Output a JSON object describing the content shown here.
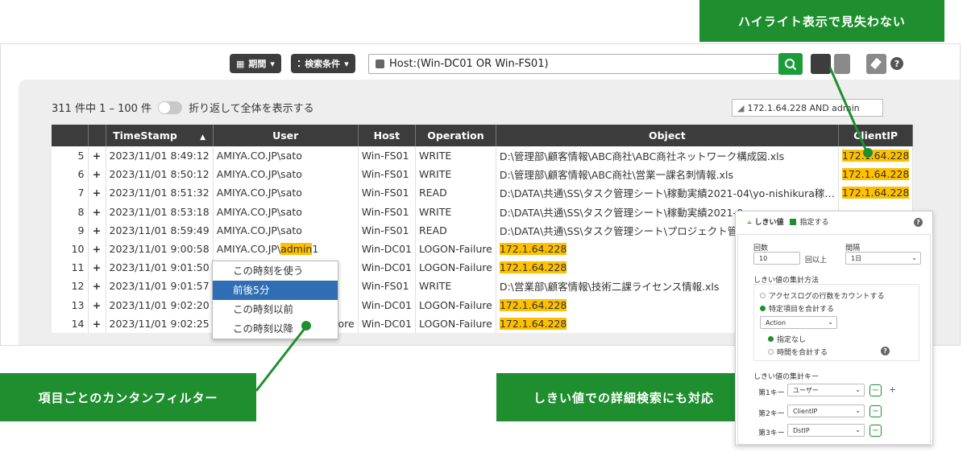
{
  "toolbar": {
    "period_label": "期間",
    "search_cond_label": "検索条件",
    "query": "Host:(Win-DC01 OR Win-FS01)"
  },
  "result": {
    "count_text": "311 件中 1 – 100 件",
    "wrap_label": "折り返して全体を表示する",
    "filter_text": "172.1.64.228  AND admin"
  },
  "table": {
    "headers": [
      "TimeStamp",
      "User",
      "Host",
      "Operation",
      "Object",
      "ClientIP"
    ],
    "rows": [
      {
        "n": "5",
        "ts": "2023/11/01 8:49:12",
        "user": "AMIYA.CO.JP\\sato",
        "host": "Win-FS01",
        "op": "WRITE",
        "obj": "D:\\管理部\\顧客情報\\ABC商社\\ABC商社ネットワーク構成図.xls",
        "ip": "172.1.64.228"
      },
      {
        "n": "6",
        "ts": "2023/11/01 8:50:12",
        "user": "AMIYA.CO.JP\\sato",
        "host": "Win-FS01",
        "op": "WRITE",
        "obj": "D:\\管理部\\顧客情報\\ABC商社\\営業一課名刺情報.xls",
        "ip": "172.1.64.228"
      },
      {
        "n": "7",
        "ts": "2023/11/01 8:51:32",
        "user": "AMIYA.CO.JP\\sato",
        "host": "Win-FS01",
        "op": "READ",
        "obj": "D:\\DATA\\共通\\SS\\タスク管理シート\\稼動実績2021-04\\yo-nishikura稼…",
        "ip": "172.1.64.228"
      },
      {
        "n": "8",
        "ts": "2023/11/01 8:53:18",
        "user": "AMIYA.CO.JP\\sato",
        "host": "Win-FS01",
        "op": "WRITE",
        "obj": "D:\\DATA\\共通\\SS\\タスク管理シート\\稼動実績2021-0",
        "ip": ""
      },
      {
        "n": "9",
        "ts": "2023/11/01 8:59:49",
        "user": "AMIYA.CO.JP\\sato",
        "host": "Win-FS01",
        "op": "READ",
        "obj": "D:\\DATA\\共通\\SS\\タスク管理シート\\プロジェクト管理",
        "ip": ""
      },
      {
        "n": "10",
        "ts": "2023/11/01 9:00:58",
        "user_prefix": "AMIYA.CO.JP\\",
        "user_hl": "admin",
        "user_suffix": "1",
        "host": "Win-DC01",
        "op": "LOGON-Failure",
        "obj_hl": "172.1.64.228",
        "ip": ""
      },
      {
        "n": "11",
        "ts": "2023/11/01 9:01:50",
        "user": "",
        "host": "Win-DC01",
        "op": "LOGON-Failure",
        "obj_hl": "172.1.64.228",
        "ip": ""
      },
      {
        "n": "12",
        "ts": "2023/11/01 9:01:57",
        "user": "",
        "host": "Win-FS01",
        "op": "WRITE",
        "obj": "D:\\営業部\\顧客情報\\技術二課ライセンス情報.xls",
        "ip": ""
      },
      {
        "n": "13",
        "ts": "2023/11/01 9:02:20",
        "user": "",
        "host": "Win-DC01",
        "op": "LOGON-Failure",
        "obj_hl": "172.1.64.228",
        "ip": ""
      },
      {
        "n": "14",
        "ts": "2023/11/01 9:02:25",
        "user": "tore",
        "host": "Win-DC01",
        "op": "LOGON-Failure",
        "obj_hl": "172.1.64.228",
        "ip": ""
      }
    ]
  },
  "context_menu": {
    "items": [
      "この時刻を使う",
      "前後5分",
      "この時刻以前",
      "この時刻以降"
    ]
  },
  "callouts": {
    "top": "ハイライト表示で見失わない",
    "left": "項目ごとのカンタンフィルター",
    "right": "しきい値での詳細検索にも対応"
  },
  "threshold": {
    "title": "しきい値",
    "enable_label": "指定する",
    "count_label": "回数",
    "count_value": "10",
    "count_suffix": "回以上",
    "interval_label": "間隔",
    "interval_value": "1日",
    "method_label": "しきい値の集計方法",
    "opt_count_rows": "アクセスログの行数をカウントする",
    "opt_sum_item": "特定項目を合計する",
    "action_value": "Action",
    "opt_none": "指定なし",
    "opt_sum_time": "時間を合計する",
    "keys_label": "しきい値の集計キー",
    "key1_label": "第1キー",
    "key1_value": "ユーザー",
    "key2_label": "第2キー",
    "key2_value": "ClientIP",
    "key3_label": "第3キー",
    "key3_value": "DstIP"
  },
  "colors": {
    "accent": "#1e8e2e",
    "highlight": "#ffc000",
    "header": "#3c3c3c"
  }
}
